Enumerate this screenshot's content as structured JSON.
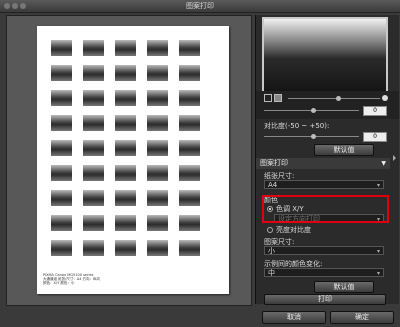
{
  "window": {
    "title": "图案打印"
  },
  "paper": {
    "footer_lines": [
      "PIXMA Canon MG5100 series",
      "大通道组 纸张/尺寸：A4 方向：纵向",
      "颜色：X/Y 颜色：小"
    ]
  },
  "sidebar": {
    "contrast_label": "对比度(-50 ~ +50):",
    "top_value": "0",
    "contrast_value": "0",
    "default_button": "默认值",
    "pattern_print_header": "图案打印",
    "paper_size_label": "纸张尺寸:",
    "paper_size_value": "A4",
    "color_label": "颜色",
    "tone_option": "色调 X/Y",
    "tone_sub_option": "设定方向打印",
    "brightness_option": "亮度对比度",
    "pattern_size_label": "图案尺寸:",
    "pattern_size_value": "小",
    "color_change_label": "示例间的颜色变化:",
    "color_change_value": "中",
    "default_button_2": "默认值",
    "print_button": "打印"
  },
  "footer": {
    "cancel": "取消",
    "ok": "确定"
  }
}
